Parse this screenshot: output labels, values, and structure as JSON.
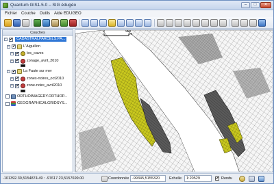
{
  "window": {
    "title": "Quantum GIS1.5.0 – SIG édugéo"
  },
  "menu": {
    "items": [
      "Fichier",
      "Couche",
      "Outils",
      "Aide EDUGEO"
    ]
  },
  "toolbar": {
    "icons": [
      "open-project-icon",
      "save-icon",
      "add-vector-icon",
      "add-raster-icon",
      "digitize-icon",
      "pan-icon",
      "zoom-in-icon",
      "zoom-out-icon",
      "zoom-full-icon",
      "zoom-layer-icon",
      "refresh-icon",
      "identify-icon",
      "select-icon",
      "measure-icon",
      "attribute-table-icon",
      "map-tips-icon",
      "label-icon",
      "bookmark-icon",
      "help-icon"
    ]
  },
  "layers_panel": {
    "title": "Couches",
    "items": [
      {
        "label": "CADASTRALPARCELS.PA...",
        "checked": true,
        "expanded": true,
        "selected": true,
        "indent": 0
      },
      {
        "label": "L'Aiguillon",
        "checked": true,
        "expanded": true,
        "selected": false,
        "indent": 1
      },
      {
        "label": "les_caves",
        "checked": true,
        "expanded": false,
        "selected": false,
        "indent": 2
      },
      {
        "label": "zonage_avril_2010",
        "checked": true,
        "expanded": false,
        "selected": false,
        "indent": 2
      },
      {
        "label": "La Faute sur mer",
        "checked": true,
        "expanded": true,
        "selected": false,
        "indent": 1
      },
      {
        "label": "zones-noires_oct2010",
        "checked": true,
        "expanded": false,
        "selected": false,
        "indent": 2
      },
      {
        "label": "zone-noire_avril2010",
        "checked": true,
        "expanded": false,
        "selected": false,
        "indent": 2
      },
      {
        "label": "ORTHOIMAGERY.ORTHOP...",
        "checked": false,
        "expanded": false,
        "selected": false,
        "indent": 0
      },
      {
        "label": "GEOGRAPHICALGRIDSYS...",
        "checked": false,
        "expanded": false,
        "selected": false,
        "indent": 0
      }
    ]
  },
  "scalebar": {
    "left_label": "0",
    "right_label": "900",
    "unit": "m"
  },
  "statusbar": {
    "coords_readout": "-101392.30,5154874.49 : -97617.23,5157699.00",
    "coord_label": "Coordonnée",
    "coord_value": "-99345,5155320",
    "scale_label": "Echelle",
    "scale_value": "1:20529",
    "render_label": "Rendu",
    "render_checked": true
  },
  "colors": {
    "accent": "#3178d6",
    "zone_fill": "#c9c81e",
    "zone_dark": "#606060"
  }
}
